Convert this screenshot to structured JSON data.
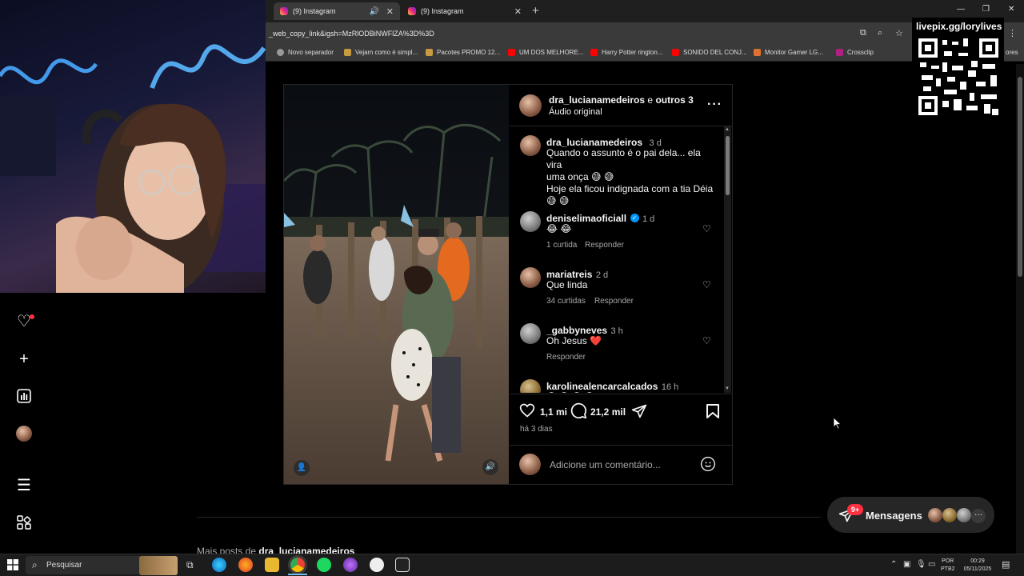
{
  "browser": {
    "tabs": [
      {
        "label": "(9) Instagram",
        "active": true
      },
      {
        "label": "(9) Instagram",
        "active": false
      }
    ],
    "url": "_web_copy_link&igsh=MzRlODBiNWFlZA%3D%3D",
    "bookmarks": [
      "Novo separador",
      "Vejam como é simpl...",
      "Pacotes PROMO 12...",
      "UM DOS MELHORE...",
      "Harry Potter rington...",
      "SONIDO DEL CONJ...",
      "Monitor Gamer LG...",
      "Crossclip"
    ],
    "bookmarks_overflow": "ores"
  },
  "overlay": {
    "qr_label": "livepix.gg/lorylives"
  },
  "post": {
    "header": {
      "username": "dra_lucianamedeiros",
      "joiner": "e",
      "others": "outros 3",
      "audio": "Áudio original",
      "more_icon": "ellipsis-icon"
    },
    "caption": {
      "username": "dra_lucianamedeiros",
      "time": "3 d",
      "line1": "Quando o assunto é o pai dela... ela vira",
      "line2": "uma onça 😅 😅",
      "line3": "Hoje ela ficou indignada com a tia Déia",
      "line4": "😅 😅"
    },
    "comments": [
      {
        "username": "deniselimaoficiall",
        "verified": true,
        "time": "1 d",
        "text": "😂 😂",
        "likes": "1 curtida",
        "reply": "Responder"
      },
      {
        "username": "mariatreis",
        "verified": false,
        "time": "2 d",
        "text": "Que linda",
        "likes": "34 curtidas",
        "reply": "Responder"
      },
      {
        "username": "_gabbyneves",
        "verified": false,
        "time": "3 h",
        "text": "Oh Jesus ❤️",
        "likes": "",
        "reply": "Responder"
      },
      {
        "username": "karolinealencarcalcados",
        "verified": false,
        "time": "16 h",
        "text": "😅 😅 😅 😅",
        "likes": "",
        "reply": ""
      }
    ],
    "actions": {
      "likes": "1,1 mi",
      "comments": "21,2 mil",
      "posted": "há 3 dias"
    },
    "comment_placeholder": "Adicione um comentário..."
  },
  "more_posts": {
    "prefix": "Mais posts de",
    "username": "dra_lucianamedeiros"
  },
  "messages": {
    "label": "Mensagens",
    "badge": "9+"
  },
  "taskbar": {
    "search_label": "Pesquisar",
    "lang_top": "POR",
    "lang_bottom": "PTB2",
    "time": "00:29",
    "date": "05/11/2025"
  },
  "colors": {
    "accent_red": "#ff3040",
    "ig_bg": "#000000",
    "verified_blue": "#0095f6"
  }
}
